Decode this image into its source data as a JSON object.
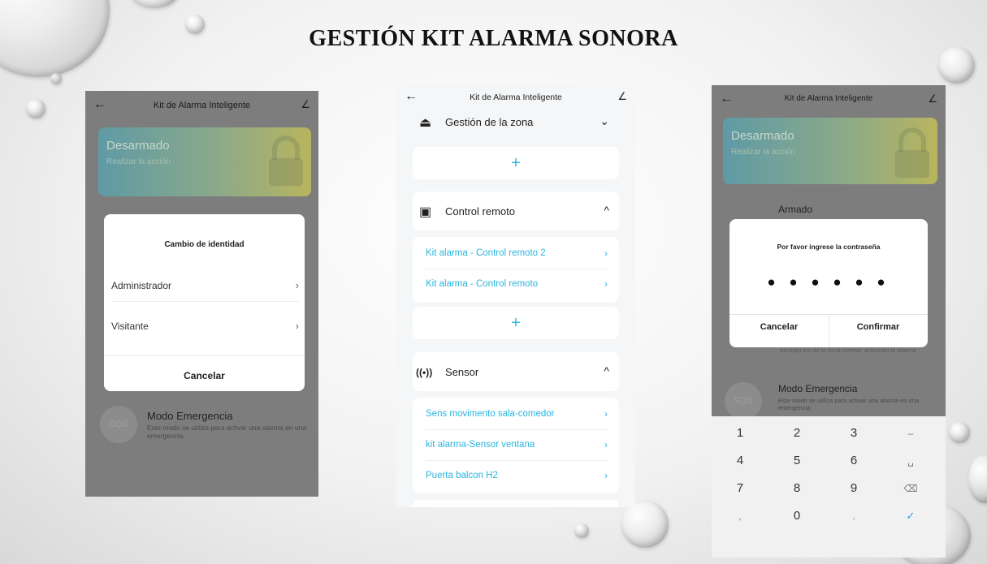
{
  "slide": {
    "title": "GESTIÓN KIT ALARMA SONORA"
  },
  "icons": {
    "back": "←",
    "edit": "∠",
    "chevron_right": "›",
    "chevron_down": "⌄",
    "chevron_up": "^",
    "plus": "+",
    "alarm": "⏏",
    "remote": "▣",
    "sensor": "((•))"
  },
  "colors": {
    "accent": "#29b6e0",
    "overlay": "#7d7d7d"
  },
  "phone1": {
    "header_title": "Kit de Alarma Inteligente",
    "status": {
      "state": "Desarmado",
      "action": "Realizar la acción"
    },
    "sheet": {
      "title": "Cambio de identidad",
      "options": [
        {
          "label": "Administrador"
        },
        {
          "label": "Visitante"
        }
      ],
      "cancel": "Cancelar"
    },
    "emergency": {
      "sos": "SOS",
      "title": "Modo Emergencia",
      "desc": "Este modo se utiliza para activar una alarma en una emergencia."
    }
  },
  "phone2": {
    "header_title": "Kit de Alarma Inteligente",
    "zone_section": {
      "label": "Gestión de la zona"
    },
    "remote_section": {
      "label": "Control remoto",
      "items": [
        "Kit alarma - Control remoto 2",
        "Kit alarma - Control remoto"
      ]
    },
    "sensor_section": {
      "label": "Sensor",
      "items": [
        "Sens movimento sala-comedor",
        "kit alarma-Sensor ventana",
        "Puerta balcon H2"
      ]
    }
  },
  "phone3": {
    "header_title": "Kit de Alarma Inteligente",
    "status": {
      "state": "Desarmado",
      "action": "Realizar la acción"
    },
    "armado": "Armado",
    "dialog": {
      "title": "Por favor ingrese la contraseña",
      "masked": "● ● ● ● ● ●",
      "cancel": "Cancelar",
      "confirm": "Confirmar"
    },
    "behind_text": "excepto los de la zona normal, activarán la alarma",
    "emergency": {
      "sos": "SOS",
      "title": "Modo Emergencia",
      "desc": "Este modo se utiliza para activar una alarma en una emergencia"
    },
    "keypad": {
      "keys": [
        "1",
        "2",
        "3",
        "–",
        "4",
        "5",
        "6",
        "␣",
        "7",
        "8",
        "9",
        "⌫",
        ",",
        "0",
        ".",
        "✓"
      ]
    }
  }
}
